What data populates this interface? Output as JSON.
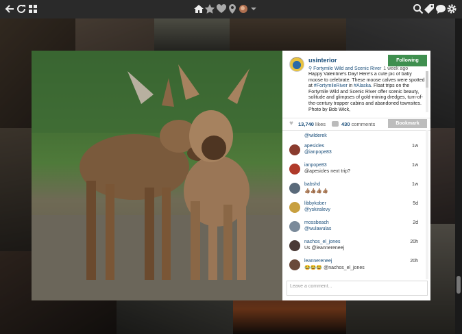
{
  "toolbar": {
    "left_icons": [
      "back-arrow-icon",
      "refresh-icon",
      "grid-icon"
    ],
    "center_icons": [
      "home-icon",
      "star-icon",
      "heart-icon",
      "location-pin-icon",
      "profile-avatar-icon",
      "chevron-down-icon"
    ],
    "right_icons": [
      "search-icon",
      "tag-icon",
      "comment-icon",
      "gear-icon"
    ]
  },
  "post": {
    "username": "usinterior",
    "follow_label": "Following",
    "location": "Fortymile Wild and Scenic River",
    "time": "1 week ago",
    "caption_before": "Happy Valentine's Day! Here's a cute pic of baby moose to celebrate. These moose calves were spotted at ",
    "caption_tag": "#FortymileRiver",
    "caption_mid": " in ",
    "caption_tag2": "#Alaska",
    "caption_after": ". Float trips on the Fortymile Wild and Scenic River offer scenic beauty, solitude and glimpses of gold-mining dredges, turn-of-the-century trapper cabins and abandoned townsites. Photo by Bob Wick,",
    "likes_count": "13,740",
    "likes_label": "likes",
    "comments_count": "430",
    "comments_label": "comments",
    "bookmark_label": "Bookmark"
  },
  "comments": [
    {
      "user": "",
      "text": "@wilderek",
      "time": ""
    },
    {
      "user": "apesicles",
      "text": "@ianpope83",
      "time": "1w"
    },
    {
      "user": "ianpope83",
      "text": "@apesicles next trip?",
      "time": "1w"
    },
    {
      "user": "babshd",
      "text": "👍🏽👍🏽👍🏽👍🏽",
      "time": "1w"
    },
    {
      "user": "libbykober",
      "text": "@yskiralevy",
      "time": "5d"
    },
    {
      "user": "mossbeach",
      "text": "@wulawulas",
      "time": "2d"
    },
    {
      "user": "nachos_el_jones",
      "text": "Us @leannereneej",
      "time": "20h"
    },
    {
      "user": "leannereneej",
      "text": "😂😂😂 @nachos_el_jones",
      "time": "20h"
    }
  ],
  "comment_input": {
    "placeholder": "Leave a comment..."
  }
}
